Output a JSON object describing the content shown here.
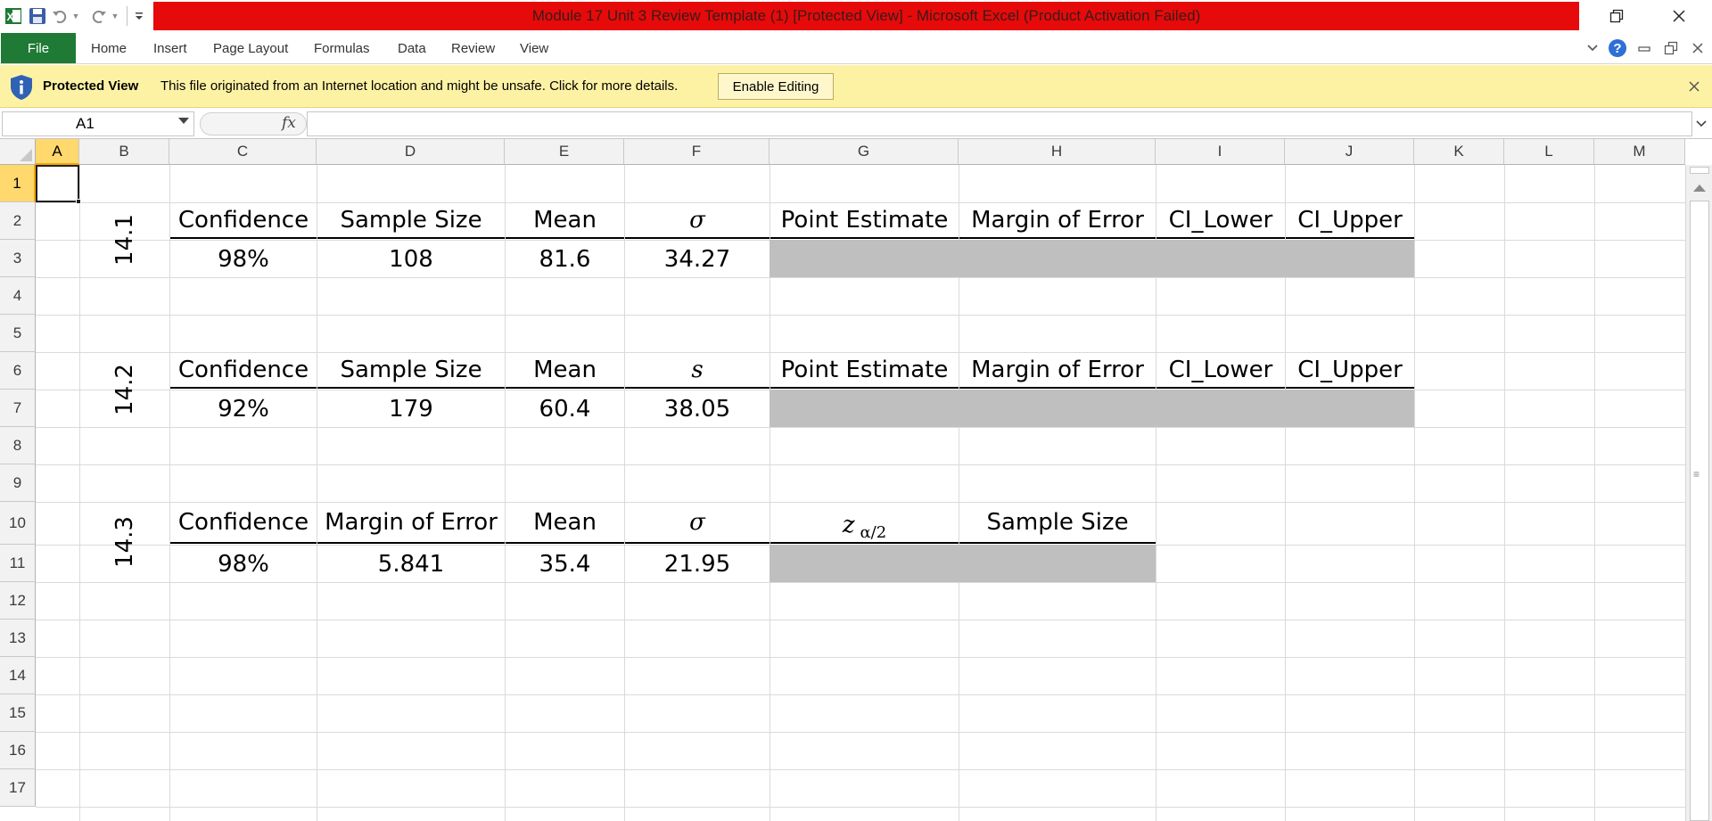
{
  "window": {
    "title": "Module 17 Unit 3 Review Template (1)  [Protected View]  -  Microsoft Excel (Product Activation Failed)",
    "title_bar_color": "#e60a0a"
  },
  "quick_access": {
    "icons": [
      "excel-app-icon",
      "save-icon",
      "undo-icon",
      "redo-icon",
      "customize-qat-icon"
    ]
  },
  "ribbon": {
    "file_label": "File",
    "file_color": "#1e7a34",
    "tabs": [
      "Home",
      "Insert",
      "Page Layout",
      "Formulas",
      "Data",
      "Review",
      "View"
    ]
  },
  "protected_view": {
    "title": "Protected View",
    "message": "This file originated from an Internet location and might be unsafe. Click for more details.",
    "button": "Enable Editing",
    "bar_color": "#fdf2a4"
  },
  "formula_bar": {
    "name_box": "A1",
    "fx": "fx",
    "formula": ""
  },
  "grid": {
    "columns": [
      "A",
      "B",
      "C",
      "D",
      "E",
      "F",
      "G",
      "H",
      "I",
      "J",
      "K",
      "L",
      "M"
    ],
    "rows": [
      "1",
      "2",
      "3",
      "4",
      "5",
      "6",
      "7",
      "8",
      "9",
      "10",
      "11",
      "12",
      "13",
      "14",
      "15",
      "16",
      "17"
    ],
    "selected_cell": "A1",
    "answer_cell_color": "#bfbfbf"
  },
  "sections": [
    {
      "label": "14.1",
      "headers": [
        "Confidence",
        "Sample Size",
        "Mean",
        "σ",
        "Point Estimate",
        "Margin of Error",
        "CI_Lower",
        "CI_Upper"
      ],
      "values": [
        "98%",
        "108",
        "81.6",
        "34.27"
      ]
    },
    {
      "label": "14.2",
      "headers": [
        "Confidence",
        "Sample Size",
        "Mean",
        "s",
        "Point Estimate",
        "Margin of Error",
        "CI_Lower",
        "CI_Upper"
      ],
      "values": [
        "92%",
        "179",
        "60.4",
        "38.05"
      ]
    },
    {
      "label": "14.3",
      "headers": [
        "Confidence",
        "Margin of Error",
        "Mean",
        "σ",
        "z",
        "Sample Size"
      ],
      "z_subscript": "α/2",
      "values": [
        "98%",
        "5.841",
        "35.4",
        "21.95"
      ]
    }
  ]
}
